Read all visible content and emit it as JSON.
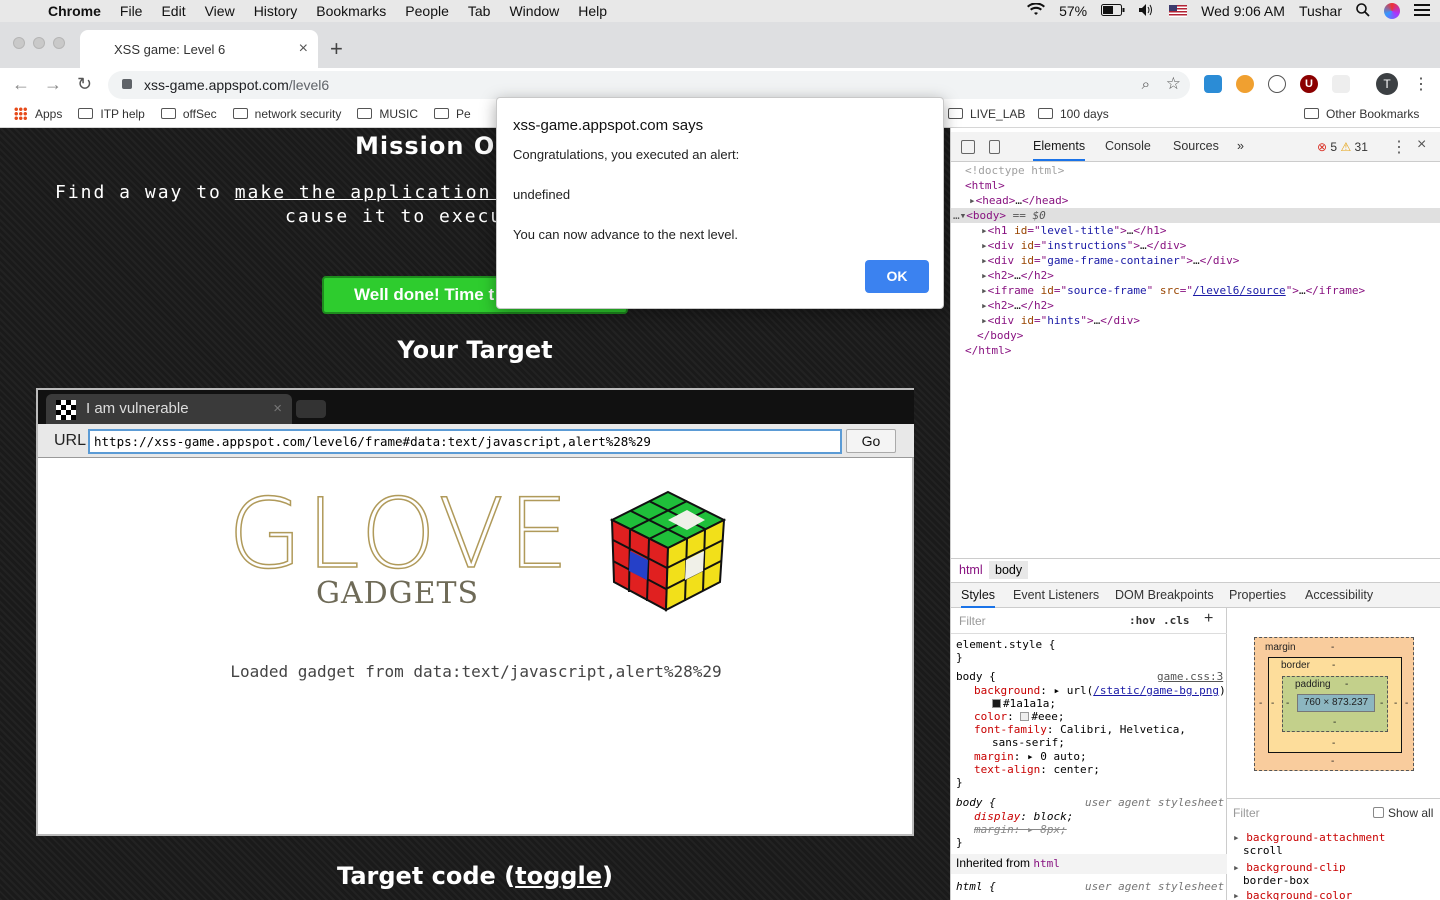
{
  "menubar": {
    "app": "Chrome",
    "items": [
      "File",
      "Edit",
      "View",
      "History",
      "Bookmarks",
      "People",
      "Tab",
      "Window",
      "Help"
    ],
    "battery": "57%",
    "clock": "Wed 9:06 AM",
    "user": "Tushar"
  },
  "browser": {
    "tab_title": "XSS game: Level 6",
    "url_host": "xss-game.appspot.com",
    "url_path": "/level6",
    "avatar_letter": "T"
  },
  "bookmarks": [
    "Apps",
    "ITP help",
    "offSec",
    "network security",
    "MUSIC",
    "Pe",
    "LIVE_LAB",
    "100 days",
    "Other Bookmarks"
  ],
  "page": {
    "mission_title": "Mission Ob",
    "find_prefix": "Find a way to ",
    "find_link": "make the application re",
    "cause_text": "cause it to execut",
    "welldone": "Well done! Time t",
    "your_target": "Your Target",
    "target_code_prefix": "Target code (",
    "target_code_link": "toggle",
    "target_code_suffix": ")"
  },
  "frame": {
    "tab_title": "I am vulnerable",
    "url_label": "URL",
    "url_value": "https://xss-game.appspot.com/level6/frame#data:text/javascript,alert%28%29",
    "go_label": "Go",
    "logo_word": "GLOVE",
    "logo_sub": "GADGETS",
    "loaded_text": "Loaded gadget from data:text/javascript,alert%28%29"
  },
  "dialog": {
    "title": "xss-game.appspot.com says",
    "line1": "Congratulations, you executed an alert:",
    "line2": "undefined",
    "line3": "You can now advance to the next level.",
    "ok_label": "OK"
  },
  "devtools": {
    "tabs": [
      "Elements",
      "Console",
      "Sources",
      "»"
    ],
    "errors": "5",
    "warnings": "31",
    "breadcrumbs": [
      "html",
      "body"
    ],
    "style_tabs": [
      "Styles",
      "Event Listeners",
      "DOM Breakpoints",
      "Properties",
      "Accessibility"
    ],
    "filter_placeholder": "Filter",
    "hov": ":hov",
    "cls": ".cls",
    "box": {
      "margin": "margin",
      "border": "border",
      "padding": "padding",
      "content": "760 × 873.237",
      "dash": "-"
    },
    "computed_filter": "Filter",
    "show_all": "Show all",
    "inherited_label": "Inherited from",
    "inherited_tag": "html",
    "css_source": "game.css:3",
    "ua_label": "user agent stylesheet",
    "computed": [
      {
        "prop": "background-attachment",
        "val": "scroll"
      },
      {
        "prop": "background-clip",
        "val": "border-box"
      },
      {
        "prop": "background-color",
        "val": ""
      }
    ]
  }
}
